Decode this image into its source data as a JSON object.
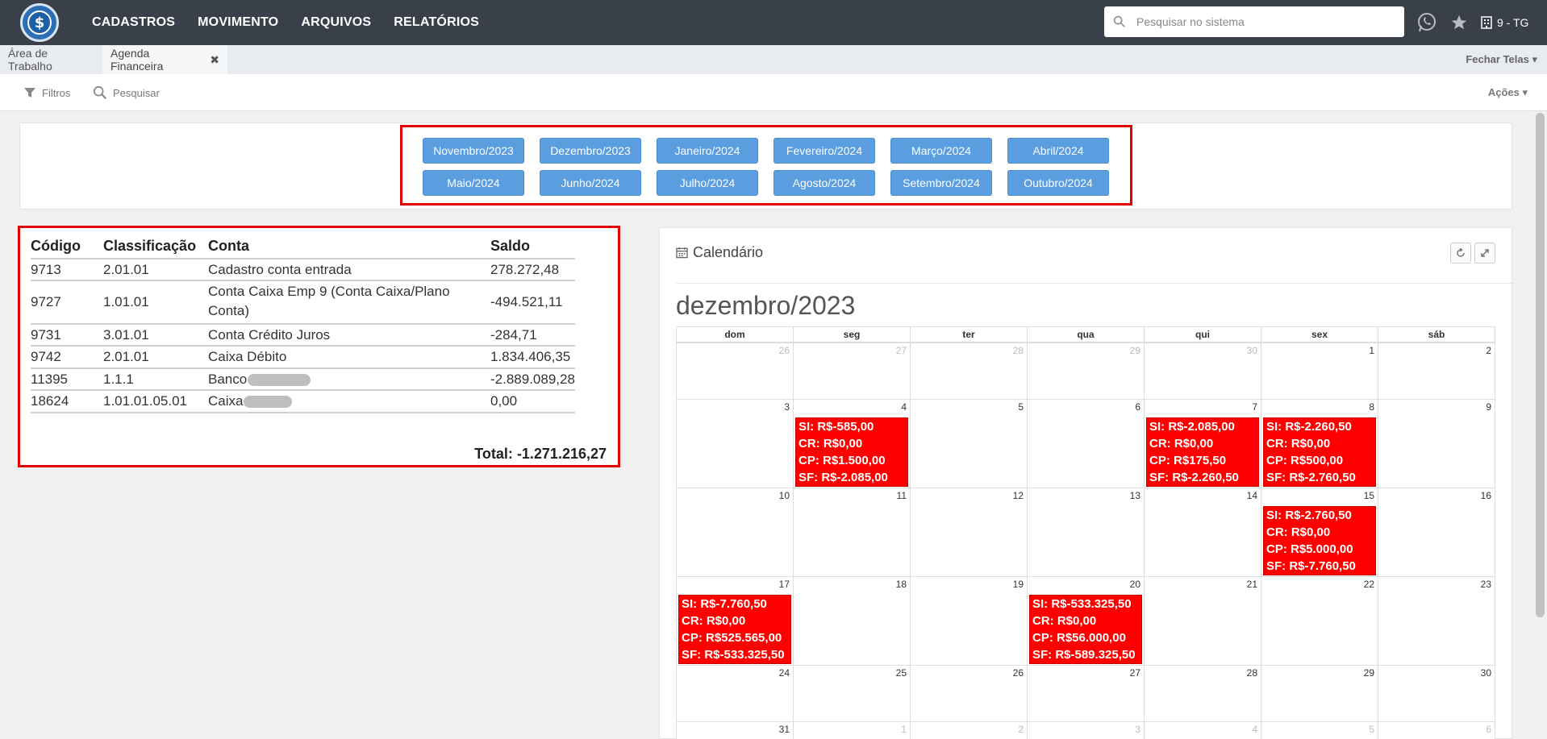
{
  "nav": {
    "menu": [
      "CADASTROS",
      "MOVIMENTO",
      "ARQUIVOS",
      "RELATÓRIOS"
    ],
    "search_placeholder": "Pesquisar no sistema",
    "company": "9 - TG"
  },
  "tabs": {
    "items": [
      "Área de Trabalho",
      "Agenda Financeira"
    ],
    "close_glyph": "✖",
    "fechar_telas": "Fechar Telas ▾"
  },
  "toolbar": {
    "filtros": "Filtros",
    "pesquisar": "Pesquisar",
    "acoes": "Ações ▾"
  },
  "months": [
    "Novembro/2023",
    "Dezembro/2023",
    "Janeiro/2024",
    "Fevereiro/2024",
    "Março/2024",
    "Abril/2024",
    "Maio/2024",
    "Junho/2024",
    "Julho/2024",
    "Agosto/2024",
    "Setembro/2024",
    "Outubro/2024"
  ],
  "balances": {
    "headers": [
      "Código",
      "Classificação",
      "Conta",
      "Saldo"
    ],
    "rows": [
      {
        "codigo": "9713",
        "classificacao": "2.01.01",
        "conta": "Cadastro conta entrada",
        "saldo": "278.272,48"
      },
      {
        "codigo": "9727",
        "classificacao": "1.01.01",
        "conta": "Conta Caixa Emp 9 (Conta Caixa/Plano",
        "conta2": "Conta)",
        "saldo": "-494.521,11"
      },
      {
        "codigo": "9731",
        "classificacao": "3.01.01",
        "conta": "Conta Crédito Juros",
        "saldo": "-284,71"
      },
      {
        "codigo": "9742",
        "classificacao": "2.01.01",
        "conta": "Caixa Débito",
        "saldo": "1.834.406,35"
      },
      {
        "codigo": "11395",
        "classificacao": "1.1.1",
        "conta": "Banco",
        "saldo": "-2.889.089,28"
      },
      {
        "codigo": "18624",
        "classificacao": "1.01.01.05.01",
        "conta": "Caixa",
        "saldo": "0,00"
      }
    ],
    "total": "Total: -1.271.216,27"
  },
  "calendar": {
    "header": "Calendário",
    "title": "dezembro/2023",
    "weekdays": [
      "dom",
      "seg",
      "ter",
      "qua",
      "qui",
      "sex",
      "sáb"
    ],
    "weeks": [
      [
        "26",
        "27",
        "28",
        "29",
        "30",
        "1",
        "2"
      ],
      [
        "3",
        "4",
        "5",
        "6",
        "7",
        "8",
        "9"
      ],
      [
        "10",
        "11",
        "12",
        "13",
        "14",
        "15",
        "16"
      ],
      [
        "17",
        "18",
        "19",
        "20",
        "21",
        "22",
        "23"
      ],
      [
        "24",
        "25",
        "26",
        "27",
        "28",
        "29",
        "30"
      ],
      [
        "31",
        "1",
        "2",
        "3",
        "4",
        "5",
        "6"
      ]
    ],
    "events": {
      "4": [
        "SI: R$-585,00",
        "CR: R$0,00",
        "CP: R$1.500,00",
        "SF: R$-2.085,00"
      ],
      "7": [
        "SI: R$-2.085,00",
        "CR: R$0,00",
        "CP: R$175,50",
        "SF: R$-2.260,50"
      ],
      "8": [
        "SI: R$-2.260,50",
        "CR: R$0,00",
        "CP: R$500,00",
        "SF: R$-2.760,50"
      ],
      "15": [
        "SI: R$-2.760,50",
        "CR: R$0,00",
        "CP: R$5.000,00",
        "SF: R$-7.760,50"
      ],
      "17": [
        "SI: R$-7.760,50",
        "CR: R$0,00",
        "CP: R$525.565,00",
        "SF: R$-533.325,50"
      ],
      "20": [
        "SI: R$-533.325,50",
        "CR: R$0,00",
        "CP: R$56.000,00",
        "SF: R$-589.325,50"
      ]
    }
  },
  "colors": {
    "navbar": "#3a4049",
    "month_button": "#5b9ee0",
    "highlight_frame": "#e00000",
    "event_bg": "#ff0000"
  }
}
